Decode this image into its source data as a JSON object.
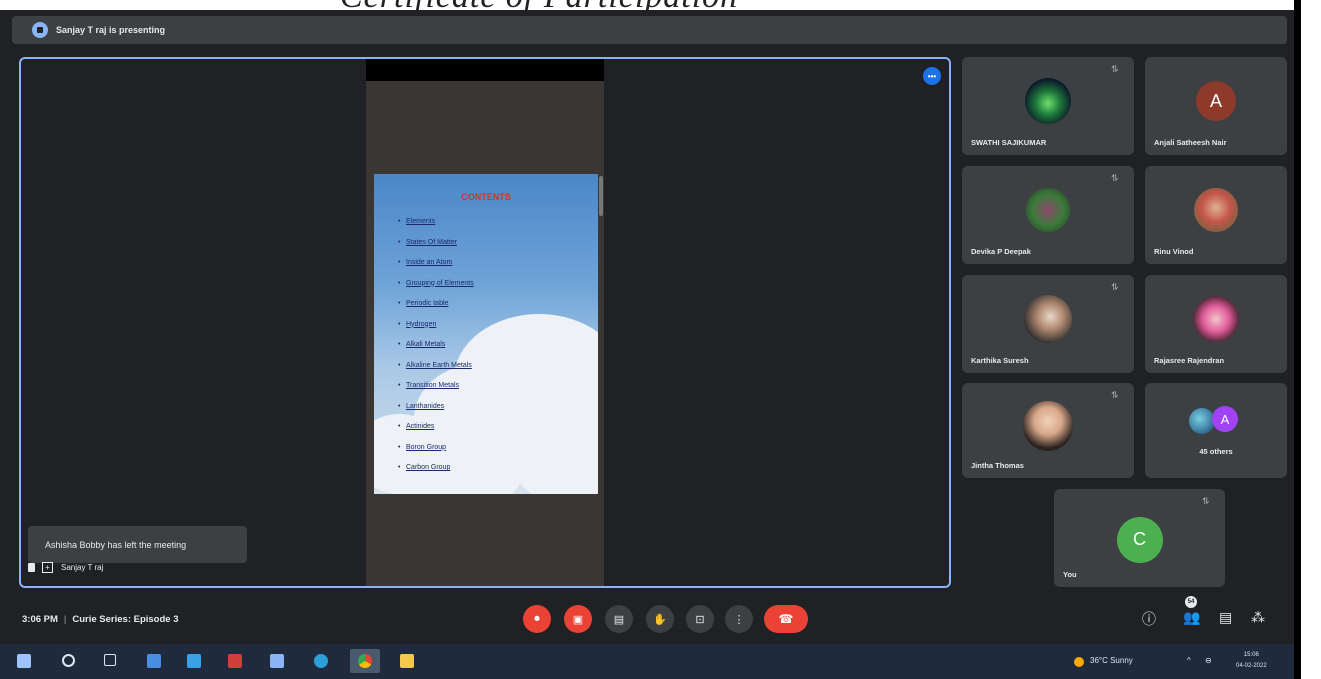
{
  "window": {
    "header_text": "Certificate of Participation"
  },
  "presentation_bar": {
    "text": "Sanjay T raj is presenting"
  },
  "slide": {
    "title": "CONTENTS",
    "items": [
      "Elements",
      "States Of Matter",
      "Inside an Atom",
      "Grouping of Elements",
      "Periodic table",
      "Hydrogen",
      "Alkali Metals",
      "Alkaline Earth Metals",
      "Transition Metals",
      "Lanthanides",
      "Actinides",
      "Boron Group",
      "Carbon Group"
    ]
  },
  "stage": {
    "pin_label": "•••",
    "toast": "Ashisha Bobby has left the meeting",
    "presenter_label": "Sanjay T raj"
  },
  "participants": [
    {
      "name": "SWATHI SAJIKUMAR"
    },
    {
      "name": "Anjali Satheesh Nair",
      "letter": "A"
    },
    {
      "name": "Devika P Deepak"
    },
    {
      "name": "Rinu Vinod"
    },
    {
      "name": "Karthika Suresh"
    },
    {
      "name": "Rajasree Rajendran"
    },
    {
      "name": "Jintha Thomas"
    },
    {
      "name": "45 others",
      "letter": "A"
    },
    {
      "name": "You",
      "letter": "C"
    }
  ],
  "bottom_bar": {
    "time": "3:06 PM",
    "meeting_name": "Curie Series: Episode 3",
    "participant_count": "54"
  },
  "taskbar": {
    "weather": "36°C  Sunny",
    "time": "15:06",
    "date": "04-02-2022"
  },
  "colors": {
    "accent": "#8ab4f8",
    "danger": "#ea4335",
    "avatar_brown": "#8d3a2b",
    "avatar_green": "#4caf50",
    "avatar_purple": "#a142f4"
  }
}
